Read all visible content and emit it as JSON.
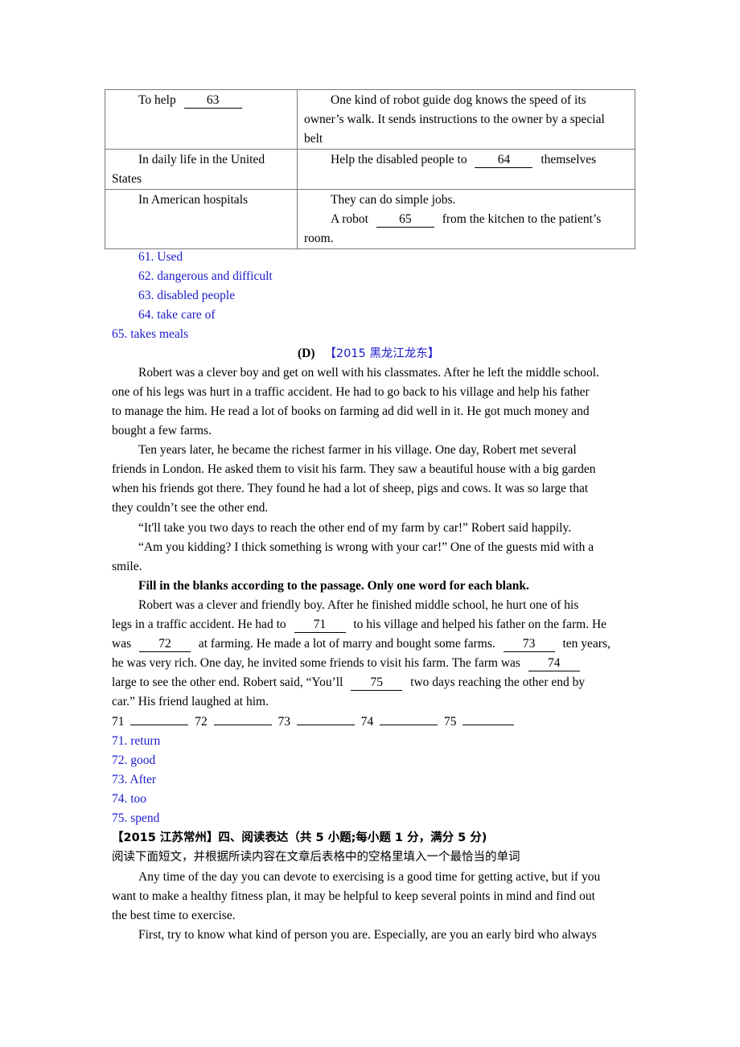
{
  "table": {
    "rows": [
      {
        "left": "To help",
        "left_blank": "63",
        "right_lines": [
          "One kind of robot guide dog knows the speed of its",
          "owner’s walk. It sends instructions to the owner by a special",
          "belt"
        ]
      },
      {
        "left_lines": [
          "In daily life in the United",
          "States"
        ],
        "right_pre": "Help the disabled people to",
        "right_blank": "64",
        "right_post": "themselves"
      },
      {
        "left": "In American hospitals",
        "right_line1": "They can do simple jobs.",
        "right_pre": "A robot",
        "right_blank": "65",
        "right_post": "from the kitchen to the patient’s",
        "right_line3": "room."
      }
    ]
  },
  "answers_c": [
    "61. Used",
    "62. dangerous and difficult",
    "63. disabled people",
    "64. take care of",
    "65. takes meals"
  ],
  "section_d": {
    "label": "(D)",
    "source": "【2015 黑龙江龙东】"
  },
  "passage": [
    "Robert was a clever boy and get on well with his classmates. After he left the middle school.",
    "one of his legs was hurt in a traffic accident. He had to go back to his village and help his father",
    "to manage the him. He read a lot of books on farming ad did well in it. He got much money and",
    "bought a few farms.",
    "Ten years later, he became the richest farmer in his village. One day, Robert met several",
    "friends in London. He asked them to visit his farm. They saw a beautiful house with a big garden",
    "when his friends got there. They found he had a lot of sheep, pigs and cows. It was so large that",
    "they couldn’t see the other end.",
    "“It'll take you two days to reach the other end of my farm by car!” Robert said happily.",
    "“Am you kidding? I thick something is wrong with your car!” One of the guests mid with a",
    "smile."
  ],
  "instruction": "Fill in the blanks according to the passage. Only one word for each blank.",
  "summary": {
    "l1": "Robert was a clever and friendly boy. After he finished middle school, he hurt one of his",
    "l2_pre": "legs in a traffic accident. He had to",
    "b71": "71",
    "l2_post": "to his village and helped his father on the farm. He",
    "l3_pre": "was",
    "b72": "72",
    "l3_mid": "at farming. He made a lot of marry and bought some farms.",
    "b73": "73",
    "l3_post": "ten years,",
    "l4_pre": "he was very rich. One day, he invited some friends to visit his farm. The farm was",
    "b74": "74",
    "l5_pre": "large to see the other end. Robert said, “You’ll",
    "b75": "75",
    "l5_post": "two days reaching the other end by",
    "l6": "car.” His friend laughed at him."
  },
  "answer_blanks": [
    "71",
    "72",
    "73",
    "74",
    "75"
  ],
  "answers_d": [
    "71. return",
    "72. good",
    "73. After",
    "74. too",
    "75. spend"
  ],
  "next_section": {
    "heading": "【2015 江苏常州】四、阅读表达（共 5 小题;每小题 1 分，满分 5 分)",
    "direction": "阅读下面短文，并根据所读内容在文章后表格中的空格里填入一个最恰当的单词",
    "paragraph_lines": [
      "Any time of the day you can devote to exercising is a good time for getting active, but if you",
      "want to make a healthy fitness plan, it may be helpful to keep several points in mind and find out",
      "the best time to exercise.",
      "First, try to know what kind of person you are. Especially, are you an early bird who always"
    ]
  },
  "colors": {
    "answer": "#1a1acc",
    "text": "#000000",
    "table_border": "#7a7a7a"
  }
}
